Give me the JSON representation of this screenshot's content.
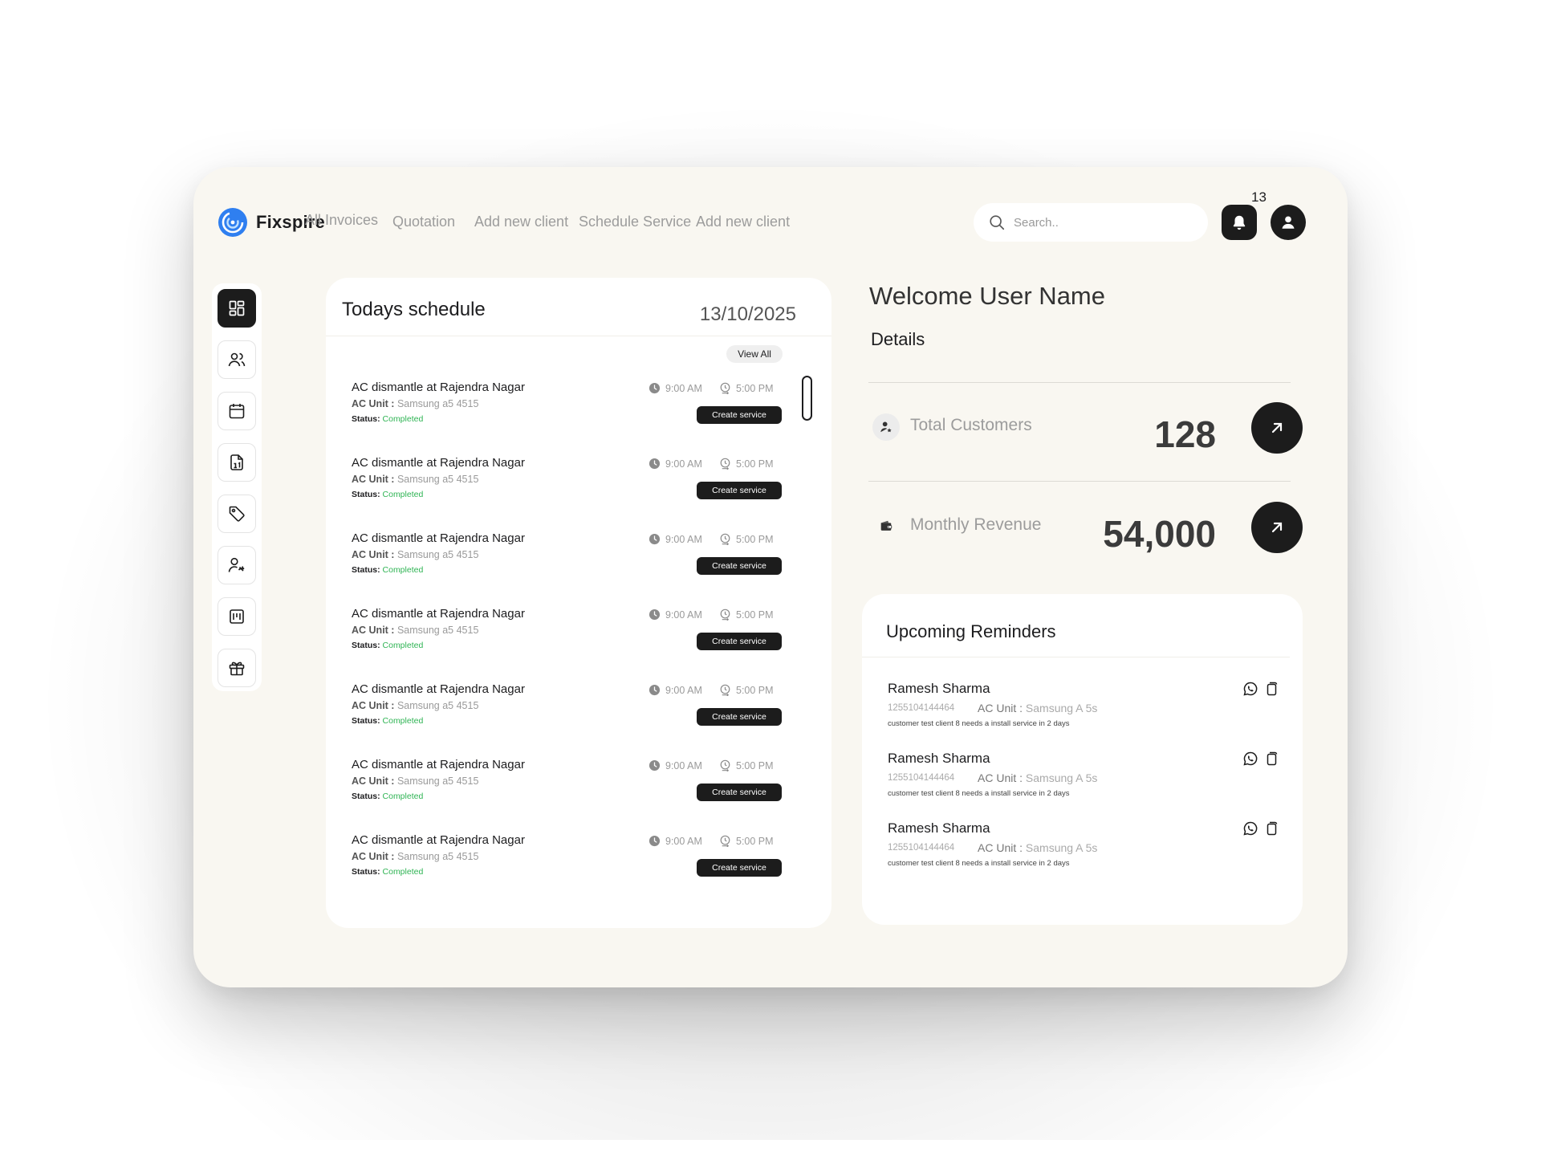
{
  "brand": {
    "name": "Fixspire",
    "accent": "#3b82f6"
  },
  "nav": [
    {
      "label": "All Invoices"
    },
    {
      "label": "Quotation"
    },
    {
      "label": "Add new client"
    },
    {
      "label": "Schedule Service"
    },
    {
      "label": "Add new client"
    }
  ],
  "search": {
    "placeholder": "Search.."
  },
  "notifications": {
    "count": "13"
  },
  "sidebar": {
    "items": [
      {
        "icon": "dashboard-icon",
        "active": true
      },
      {
        "icon": "users-icon"
      },
      {
        "icon": "calendar-icon"
      },
      {
        "icon": "invoice-icon"
      },
      {
        "icon": "tag-icon"
      },
      {
        "icon": "technician-icon"
      },
      {
        "icon": "board-icon"
      },
      {
        "icon": "gift-icon"
      }
    ]
  },
  "schedule": {
    "title": "Todays schedule",
    "date": "13/10/2025",
    "view_all": "View All",
    "rows": [
      {
        "title": "AC dismantle at Rajendra Nagar",
        "unit_label": "AC Unit :",
        "unit_value": "Samsung a5 4515",
        "status_label": "Status:",
        "status_value": "Completed",
        "start": "9:00 AM",
        "end": "5:00 PM",
        "button": "Create service"
      },
      {
        "title": "AC dismantle at Rajendra Nagar",
        "unit_label": "AC Unit :",
        "unit_value": "Samsung a5 4515",
        "status_label": "Status:",
        "status_value": "Completed",
        "start": "9:00 AM",
        "end": "5:00 PM",
        "button": "Create service"
      },
      {
        "title": "AC dismantle at Rajendra Nagar",
        "unit_label": "AC Unit :",
        "unit_value": "Samsung a5 4515",
        "status_label": "Status:",
        "status_value": "Completed",
        "start": "9:00 AM",
        "end": "5:00 PM",
        "button": "Create service"
      },
      {
        "title": "AC dismantle at Rajendra Nagar",
        "unit_label": "AC Unit :",
        "unit_value": "Samsung a5 4515",
        "status_label": "Status:",
        "status_value": "Completed",
        "start": "9:00 AM",
        "end": "5:00 PM",
        "button": "Create service"
      },
      {
        "title": "AC dismantle at Rajendra Nagar",
        "unit_label": "AC Unit :",
        "unit_value": "Samsung a5 4515",
        "status_label": "Status:",
        "status_value": "Completed",
        "start": "9:00 AM",
        "end": "5:00 PM",
        "button": "Create service"
      },
      {
        "title": "AC dismantle at Rajendra Nagar",
        "unit_label": "AC Unit :",
        "unit_value": "Samsung a5 4515",
        "status_label": "Status:",
        "status_value": "Completed",
        "start": "9:00 AM",
        "end": "5:00 PM",
        "button": "Create service"
      },
      {
        "title": "AC dismantle at Rajendra Nagar",
        "unit_label": "AC Unit :",
        "unit_value": "Samsung a5 4515",
        "status_label": "Status:",
        "status_value": "Completed",
        "start": "9:00 AM",
        "end": "5:00 PM",
        "button": "Create service"
      }
    ]
  },
  "welcome": {
    "title": "Welcome User Name",
    "details": "Details"
  },
  "stats": {
    "customers": {
      "label": "Total  Customers",
      "value": "128",
      "icon": "customer-icon"
    },
    "revenue": {
      "label": "Monthly Revenue",
      "value": "54,000",
      "icon": "wallet-icon"
    }
  },
  "reminders": {
    "title": "Upcoming Reminders",
    "items": [
      {
        "name": "Ramesh Sharma",
        "phone": "1255104144464",
        "unit_label": "AC Unit :",
        "unit_value": "Samsung A 5s",
        "note": "customer test client 8 needs a install service in 2 days"
      },
      {
        "name": "Ramesh Sharma",
        "phone": "1255104144464",
        "unit_label": "AC Unit :",
        "unit_value": "Samsung A 5s",
        "note": "customer test client 8 needs a install service in 2 days"
      },
      {
        "name": "Ramesh Sharma",
        "phone": "1255104144464",
        "unit_label": "AC Unit :",
        "unit_value": "Samsung A 5s",
        "note": "customer test client 8 needs a install service in 2 days"
      }
    ]
  },
  "colors": {
    "status_completed": "#2fb454",
    "dark": "#1c1c1c",
    "panel_bg": "#f9f7f1"
  }
}
